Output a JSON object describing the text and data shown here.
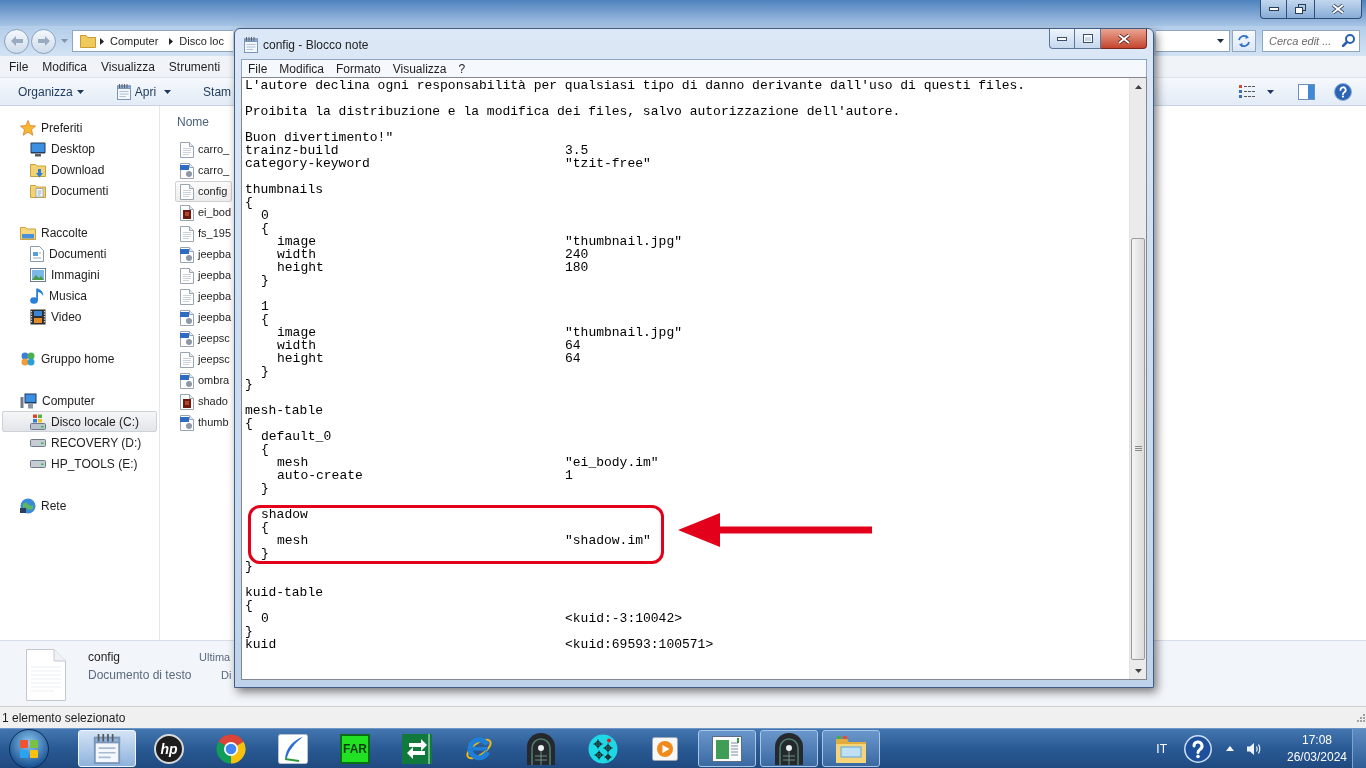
{
  "explorer": {
    "breadcrumb": [
      "Computer",
      "Disco loc"
    ],
    "search": {
      "placeholder": "Cerca edit ..."
    },
    "menu": [
      "File",
      "Modifica",
      "Visualizza",
      "Strumenti"
    ],
    "toolbar": [
      {
        "label": "Organizza",
        "kind": "menu"
      },
      {
        "label": "Apri",
        "kind": "open"
      },
      {
        "label": "Stam",
        "kind": "button"
      }
    ],
    "navigation": [
      {
        "label": "Preferiti",
        "kind": "favorites",
        "selected": false,
        "children": [
          {
            "label": "Desktop",
            "kind": "desktop",
            "selected": false
          },
          {
            "label": "Download",
            "kind": "downloads",
            "selected": false
          },
          {
            "label": "Documenti",
            "kind": "documents",
            "selected": false
          }
        ]
      },
      {
        "label": "Raccolte",
        "kind": "libraries",
        "selected": false,
        "children": [
          {
            "label": "Documenti",
            "kind": "document",
            "selected": false
          },
          {
            "label": "Immagini",
            "kind": "pictures",
            "selected": false
          },
          {
            "label": "Musica",
            "kind": "music",
            "selected": false
          },
          {
            "label": "Video",
            "kind": "video",
            "selected": false
          }
        ]
      },
      {
        "label": "Gruppo home",
        "kind": "homegroup",
        "selected": false
      },
      {
        "label": "Computer",
        "kind": "computer",
        "selected": false,
        "children": [
          {
            "label": "Disco locale (C:)",
            "kind": "systemdrive",
            "selected": true
          },
          {
            "label": "RECOVERY (D:)",
            "kind": "drive",
            "selected": false
          },
          {
            "label": "HP_TOOLS (E:)",
            "kind": "drive",
            "selected": false
          }
        ]
      },
      {
        "label": "Rete",
        "kind": "network",
        "selected": false
      }
    ],
    "file_list": {
      "column": "Nome",
      "files": [
        {
          "name": "carro_",
          "kind": "text",
          "selected": false
        },
        {
          "name": "carro_",
          "kind": "image",
          "selected": false
        },
        {
          "name": "config",
          "kind": "text",
          "selected": true
        },
        {
          "name": "ei_bod",
          "kind": "block",
          "selected": false
        },
        {
          "name": "fs_195",
          "kind": "text",
          "selected": false
        },
        {
          "name": "jeepba",
          "kind": "image",
          "selected": false
        },
        {
          "name": "jeepba",
          "kind": "text",
          "selected": false
        },
        {
          "name": "jeepba",
          "kind": "text",
          "selected": false
        },
        {
          "name": "jeepba",
          "kind": "image",
          "selected": false
        },
        {
          "name": "jeepsc",
          "kind": "image",
          "selected": false
        },
        {
          "name": "jeepsc",
          "kind": "text",
          "selected": false
        },
        {
          "name": "ombra",
          "kind": "image",
          "selected": false
        },
        {
          "name": "shado",
          "kind": "block",
          "selected": false
        },
        {
          "name": "thumb",
          "kind": "image",
          "selected": false
        }
      ]
    },
    "details": {
      "name": "config",
      "type": "Documento di testo",
      "labels": [
        "Ultima",
        "Di"
      ]
    },
    "status_bar": "1 elemento selezionato"
  },
  "notepad": {
    "title": "config - Blocco note",
    "menu": [
      "File",
      "Modifica",
      "Formato",
      "Visualizza",
      "?"
    ],
    "document": {
      "sections": [
        [
          {
            "key": "L'autore declina ogni responsabilità per qualsiasi tipo di danno derivante dall'uso di questi files."
          }
        ],
        [
          {
            "key": "Proibita la distribuzione e la modifica dei files, salvo autorizzazione dell'autore."
          }
        ],
        [
          {
            "key": "Buon divertimento!\""
          },
          {
            "key": "trainz-build",
            "value": "3.5"
          },
          {
            "key": "category-keyword",
            "value": "\"tzit-free\""
          }
        ],
        [
          {
            "key": "thumbnails",
            "open": "{",
            "close": "}",
            "sections": [
              [
                {
                  "key": "0",
                  "open": "{",
                  "close": "}",
                  "sections": [
                    [
                      {
                        "key": "image",
                        "value": "\"thumbnail.jpg\""
                      },
                      {
                        "key": "width",
                        "value": "240"
                      },
                      {
                        "key": "height",
                        "value": "180"
                      }
                    ]
                  ]
                }
              ],
              [
                {
                  "key": "1",
                  "open": "{",
                  "close": "}",
                  "sections": [
                    [
                      {
                        "key": "image",
                        "value": "\"thumbnail.jpg\""
                      },
                      {
                        "key": "width",
                        "value": "64"
                      },
                      {
                        "key": "height",
                        "value": "64"
                      }
                    ]
                  ]
                }
              ]
            ]
          }
        ],
        [
          {
            "key": "mesh-table",
            "open": "{",
            "close": "}",
            "sections": [
              [
                {
                  "key": "default_0",
                  "highlighted": false,
                  "open": "{",
                  "close": "}",
                  "sections": [
                    [
                      {
                        "key": "mesh",
                        "value": "\"ei_body.im\""
                      },
                      {
                        "key": "auto-create",
                        "value": "1"
                      }
                    ]
                  ]
                }
              ],
              [
                {
                  "key": "shadow",
                  "highlighted": true,
                  "open": "{",
                  "close": "}",
                  "sections": [
                    [
                      {
                        "key": "mesh",
                        "value": "\"shadow.im\""
                      }
                    ]
                  ]
                }
              ]
            ]
          }
        ],
        [
          {
            "key": "kuid-table",
            "open": "{",
            "close": "}",
            "sections": [
              [
                {
                  "key": "0",
                  "value": "<kuid:-3:10042>"
                }
              ]
            ]
          },
          {
            "key": "kuid",
            "value": "<kuid:69593:100571>"
          }
        ]
      ]
    }
  },
  "taskbar": {
    "apps": [
      {
        "kind": "notepad",
        "running": true,
        "selected": true
      },
      {
        "kind": "hp",
        "label": "hp",
        "running": false,
        "selected": false
      },
      {
        "kind": "chrome",
        "running": false,
        "selected": false
      },
      {
        "kind": "quill",
        "running": false,
        "selected": false
      },
      {
        "kind": "far",
        "label": "FAR",
        "running": false,
        "selected": false
      },
      {
        "kind": "arrows",
        "running": false,
        "selected": false
      },
      {
        "kind": "ie",
        "running": false,
        "selected": false
      },
      {
        "kind": "locomotive",
        "running": false,
        "selected": false
      },
      {
        "kind": "crosshairs",
        "running": false,
        "selected": false
      },
      {
        "kind": "media",
        "running": false,
        "selected": false
      },
      {
        "kind": "viewer",
        "running": true,
        "selected": false
      },
      {
        "kind": "locomotive",
        "running": true,
        "selected": false
      },
      {
        "kind": "folder",
        "running": true,
        "selected": false
      }
    ],
    "tray": {
      "language": "IT",
      "time": "17:08",
      "date": "26/03/2024"
    }
  }
}
